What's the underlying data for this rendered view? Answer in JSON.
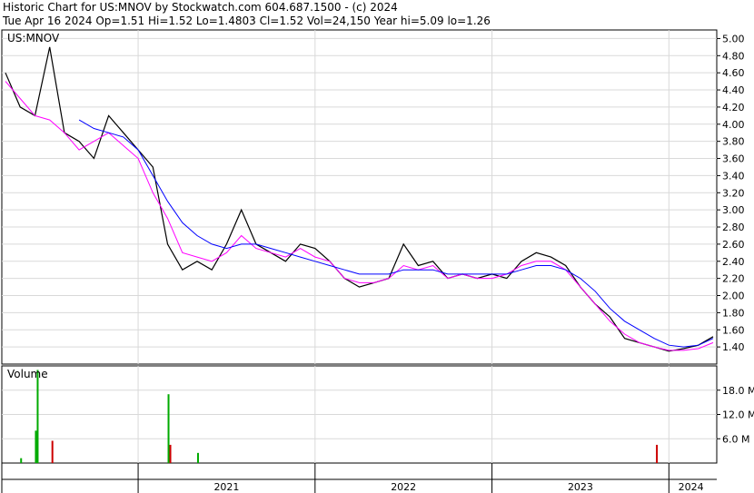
{
  "header": {
    "line1": "Historic Chart for US:MNOV by Stockwatch.com 604.687.1500 - (c) 2024",
    "line2": "Tue Apr 16 2024   Op=1.51   Hi=1.52   Lo=1.4803   Cl=1.52   Vol=24,150   Year hi=5.09   lo=1.26"
  },
  "colors": {
    "price": "#000000",
    "ma_short": "#ff00ff",
    "ma_long": "#0000ff",
    "volume_up": "#00aa00",
    "volume_down": "#cc0000",
    "grid": "#d9d9d9"
  },
  "chart_data": [
    {
      "type": "line",
      "panel": "price",
      "label": "US:MNOV",
      "ylim": [
        1.2,
        5.1
      ],
      "yticks": [
        "5.00",
        "4.80",
        "4.60",
        "4.40",
        "4.20",
        "4.00",
        "3.80",
        "3.60",
        "3.40",
        "3.20",
        "3.00",
        "2.80",
        "2.60",
        "2.40",
        "2.20",
        "2.00",
        "1.80",
        "1.60",
        "1.40"
      ],
      "xticks": [
        "2021",
        "2022",
        "2023",
        "2024"
      ],
      "grid": true,
      "x": [
        "2020-04",
        "2020-05",
        "2020-06",
        "2020-07",
        "2020-08",
        "2020-09",
        "2020-10",
        "2020-11",
        "2020-12",
        "2021-01",
        "2021-02",
        "2021-03",
        "2021-04",
        "2021-05",
        "2021-06",
        "2021-07",
        "2021-08",
        "2021-09",
        "2021-10",
        "2021-11",
        "2021-12",
        "2022-01",
        "2022-02",
        "2022-03",
        "2022-04",
        "2022-05",
        "2022-06",
        "2022-07",
        "2022-08",
        "2022-09",
        "2022-10",
        "2022-11",
        "2022-12",
        "2023-01",
        "2023-02",
        "2023-03",
        "2023-04",
        "2023-05",
        "2023-06",
        "2023-07",
        "2023-08",
        "2023-09",
        "2023-10",
        "2023-11",
        "2023-12",
        "2024-01",
        "2024-02",
        "2024-03",
        "2024-04"
      ],
      "series": [
        {
          "values": [
            4.6,
            4.2,
            4.1,
            4.9,
            3.9,
            3.8,
            3.6,
            4.1,
            3.9,
            3.7,
            3.5,
            2.6,
            2.3,
            2.4,
            2.3,
            2.6,
            3.0,
            2.6,
            2.5,
            2.4,
            2.6,
            2.55,
            2.4,
            2.2,
            2.1,
            2.15,
            2.2,
            2.6,
            2.35,
            2.4,
            2.2,
            2.25,
            2.2,
            2.25,
            2.2,
            2.4,
            2.5,
            2.45,
            2.35,
            2.1,
            1.9,
            1.75,
            1.5,
            1.45,
            1.4,
            1.35,
            1.38,
            1.42,
            1.52
          ]
        },
        {
          "values": [
            4.5,
            4.3,
            4.1,
            4.05,
            3.9,
            3.7,
            3.8,
            3.9,
            3.75,
            3.6,
            3.2,
            2.9,
            2.5,
            2.45,
            2.4,
            2.5,
            2.7,
            2.55,
            2.5,
            2.45,
            2.55,
            2.45,
            2.4,
            2.2,
            2.15,
            2.15,
            2.2,
            2.35,
            2.3,
            2.35,
            2.2,
            2.25,
            2.2,
            2.2,
            2.25,
            2.35,
            2.4,
            2.4,
            2.3,
            2.1,
            1.9,
            1.7,
            1.55,
            1.45,
            1.4,
            1.36,
            1.36,
            1.38,
            1.45
          ]
        },
        {
          "values": [
            null,
            null,
            null,
            null,
            null,
            4.05,
            3.95,
            3.9,
            3.85,
            3.7,
            3.4,
            3.1,
            2.85,
            2.7,
            2.6,
            2.55,
            2.6,
            2.6,
            2.55,
            2.5,
            2.45,
            2.4,
            2.35,
            2.3,
            2.25,
            2.25,
            2.25,
            2.3,
            2.3,
            2.3,
            2.25,
            2.25,
            2.25,
            2.25,
            2.25,
            2.3,
            2.35,
            2.35,
            2.3,
            2.2,
            2.05,
            1.85,
            1.7,
            1.6,
            1.5,
            1.42,
            1.4,
            1.42,
            1.5
          ]
        }
      ]
    },
    {
      "type": "bar",
      "panel": "volume",
      "label": "Volume",
      "ylim": [
        0,
        24
      ],
      "yticks": [
        "18.0 M",
        "12.0 M",
        "6.0 M"
      ],
      "bars": [
        {
          "x": "2020-05",
          "value": 1.2
        },
        {
          "x": "2020-06",
          "value": 23.0
        },
        {
          "x": "2020-06",
          "value": 8.0
        },
        {
          "x": "2020-07",
          "value": 5.5
        },
        {
          "x": "2021-03",
          "value": 17.0
        },
        {
          "x": "2021-03",
          "value": 4.5
        },
        {
          "x": "2021-05",
          "value": 2.5
        },
        {
          "x": "2023-12",
          "value": 4.5
        }
      ]
    }
  ]
}
